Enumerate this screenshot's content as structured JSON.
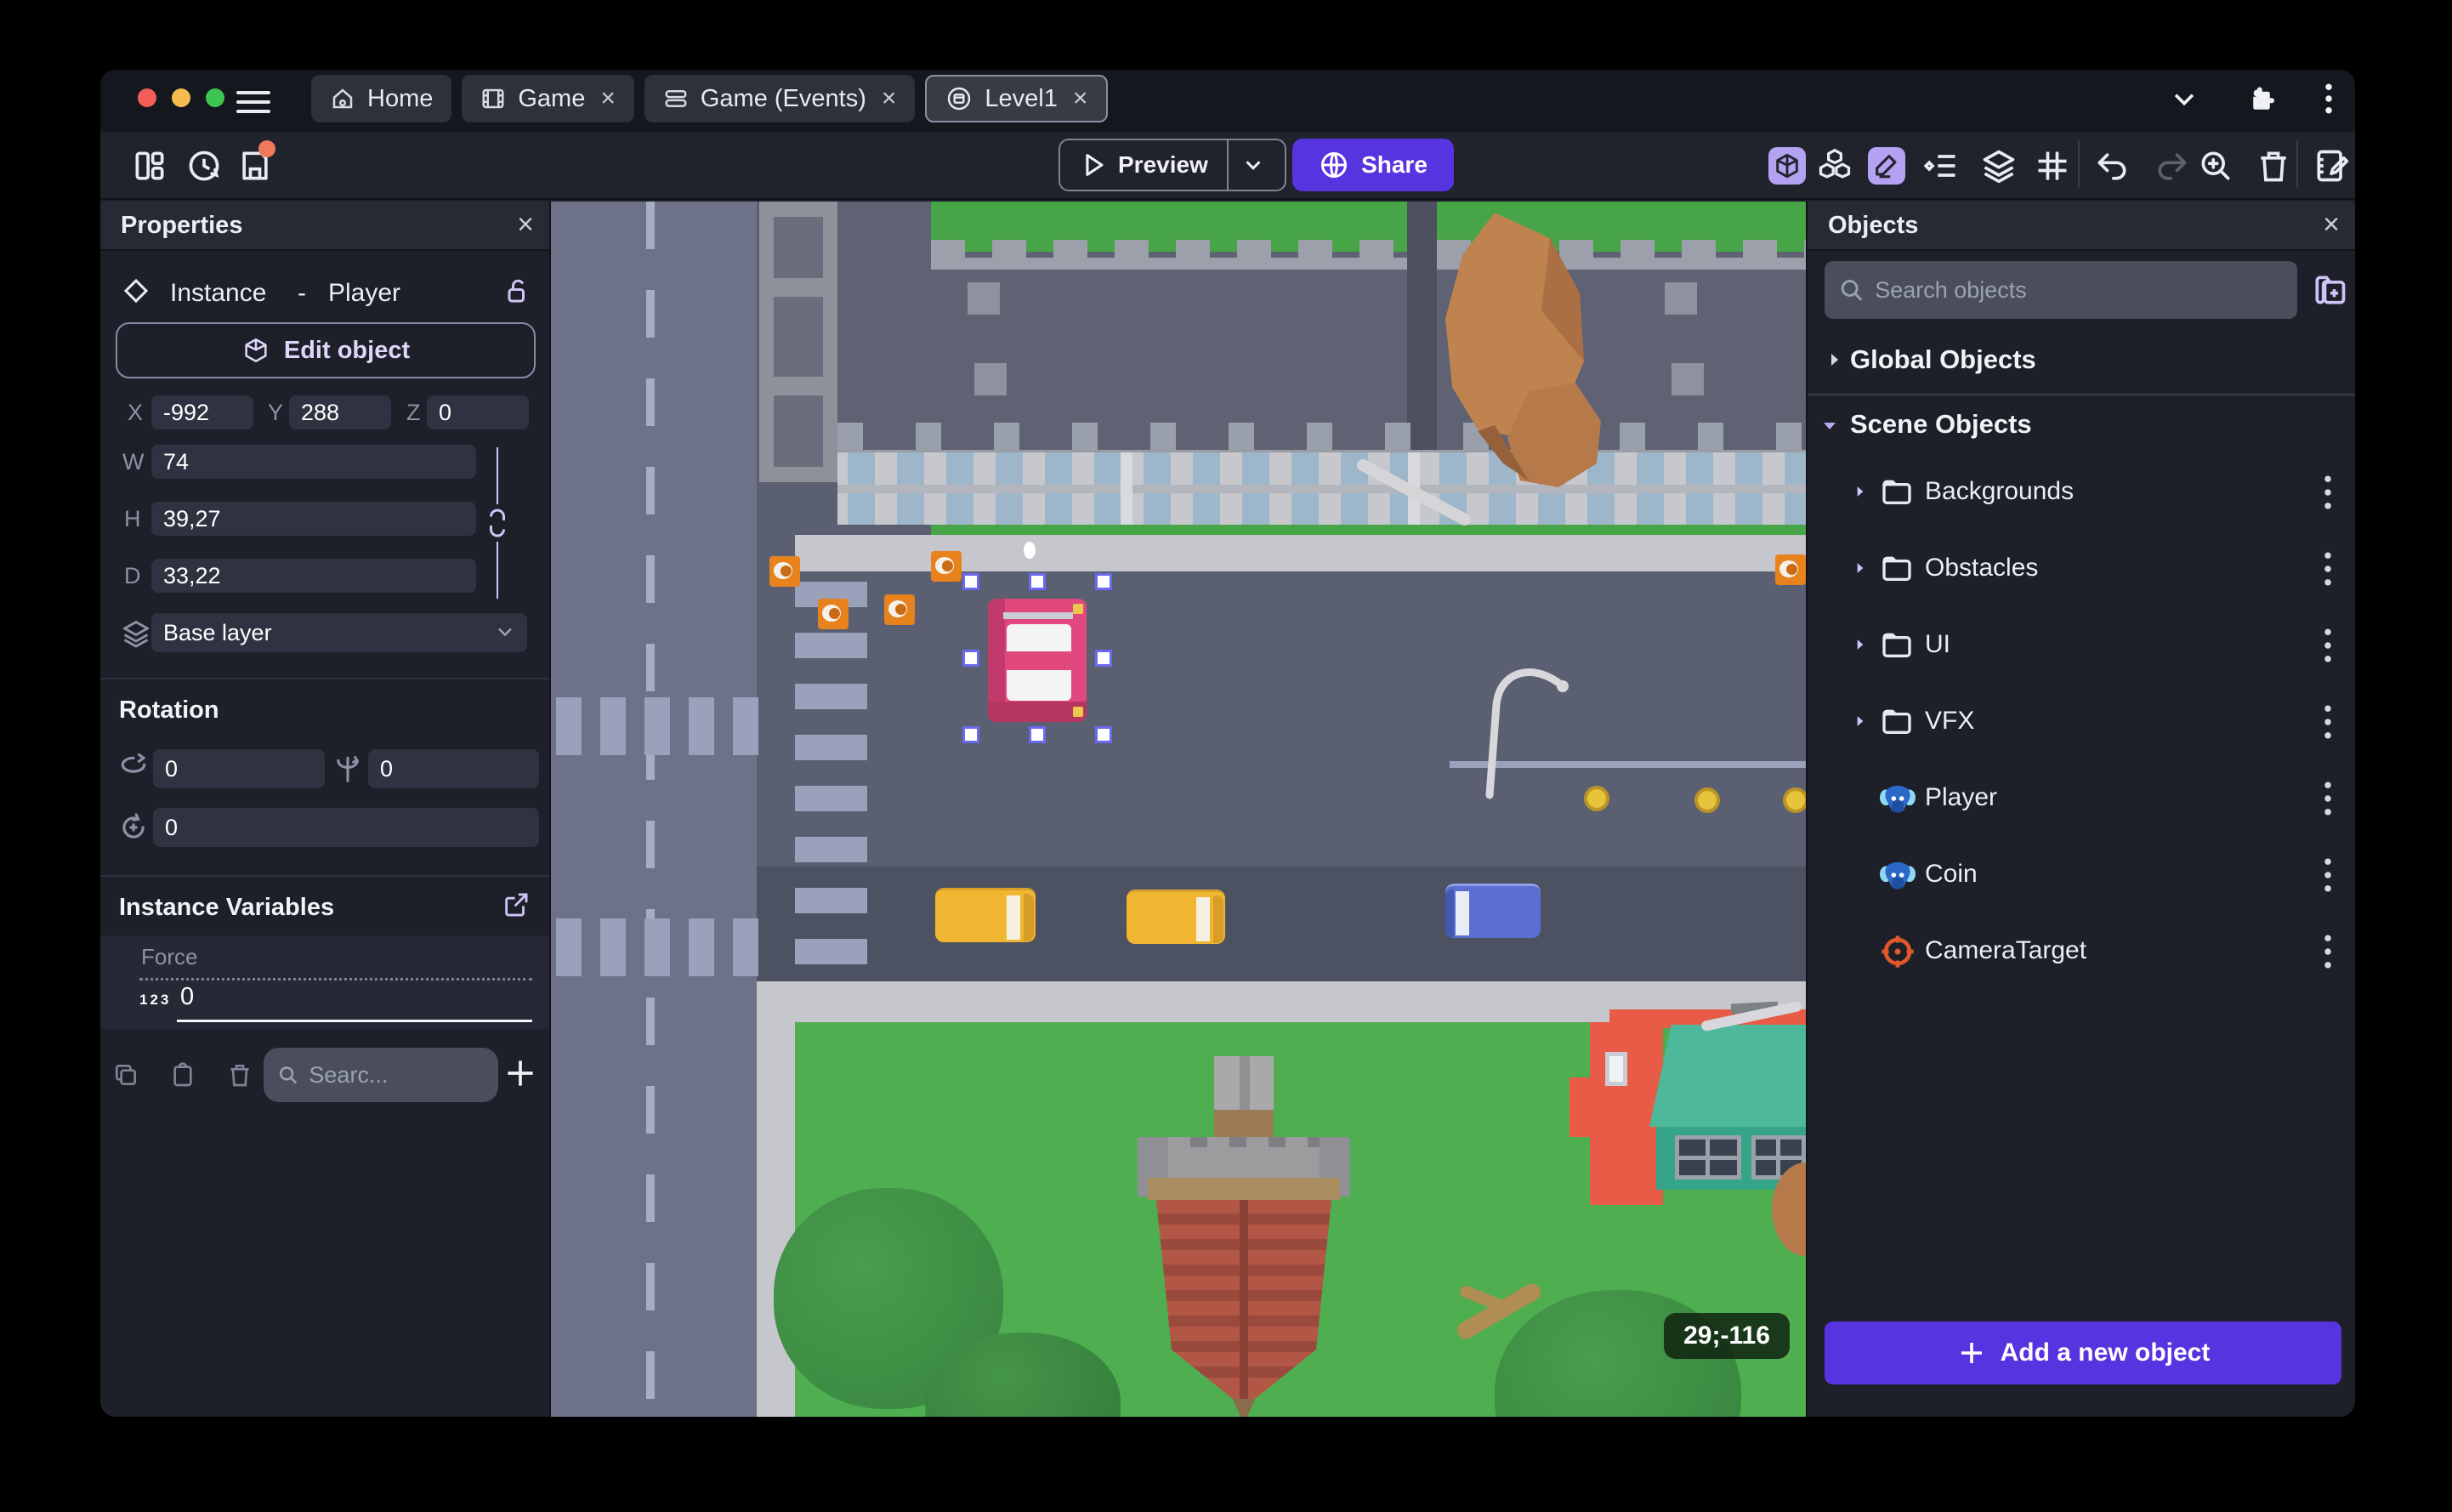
{
  "titlebar": {
    "tabs": [
      {
        "label": "Home",
        "icon": "home-icon"
      },
      {
        "label": "Game",
        "icon": "film-icon"
      },
      {
        "label": "Game (Events)",
        "icon": "events-icon"
      },
      {
        "label": "Level1",
        "icon": "scene-icon"
      }
    ],
    "close_glyph": "×"
  },
  "toolbar": {
    "preview_label": "Preview",
    "share_label": "Share"
  },
  "properties": {
    "title": "Properties",
    "close_glyph": "×",
    "instance_label": "Instance",
    "separator": "-",
    "object_name": "Player",
    "edit_object_label": "Edit object",
    "labels": {
      "x": "X",
      "y": "Y",
      "z": "Z",
      "w": "W",
      "h": "H",
      "d": "D"
    },
    "position": {
      "x": "-992",
      "y": "288",
      "z": "0"
    },
    "size": {
      "w": "74",
      "h": "39,27",
      "d": "33,22"
    },
    "layer_value": "Base layer",
    "rotation_title": "Rotation",
    "rotation": {
      "x": "0",
      "y": "0",
      "z": "0"
    },
    "instance_variables_title": "Instance Variables",
    "variable": {
      "name": "Force",
      "type_badge": "123",
      "value": "0"
    },
    "variables_search_placeholder": "Searc..."
  },
  "objects": {
    "title": "Objects",
    "close_glyph": "×",
    "search_placeholder": "Search objects",
    "global_label": "Global Objects",
    "scene_label": "Scene Objects",
    "folders": [
      {
        "label": "Backgrounds"
      },
      {
        "label": "Obstacles"
      },
      {
        "label": "UI"
      },
      {
        "label": "VFX"
      }
    ],
    "items": [
      {
        "label": "Player",
        "icon": "model3d-icon"
      },
      {
        "label": "Coin",
        "icon": "model3d-icon"
      },
      {
        "label": "CameraTarget",
        "icon": "camera-target-icon"
      }
    ],
    "add_button_label": "Add a new object"
  },
  "canvas": {
    "coordinates_badge": "29;-116"
  },
  "colors": {
    "accent": "#5634e0",
    "toolbar_highlight": "#b3a1f2",
    "save_indicator": "#f0795a",
    "traffic_red": "#f45c57",
    "traffic_yellow": "#f5bd4f",
    "traffic_green": "#3ec450",
    "selection": "#6a6af0"
  }
}
